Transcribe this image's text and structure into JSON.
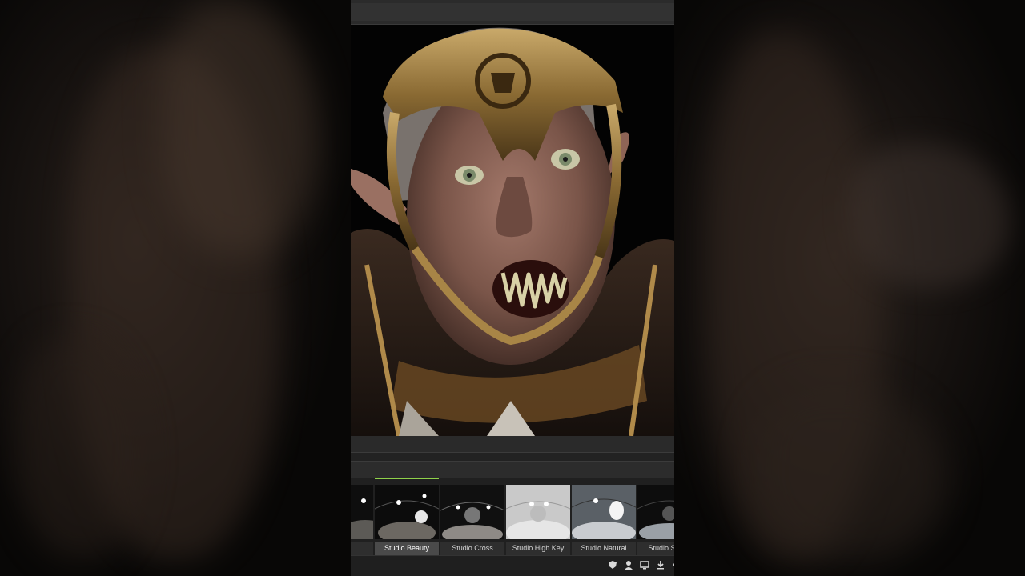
{
  "viewer": {
    "subject": "orc-warrior-bust-render"
  },
  "hdri_presets": {
    "items": [
      {
        "label": "",
        "selected": false
      },
      {
        "label": "Studio Beauty",
        "selected": true
      },
      {
        "label": "Studio Cross",
        "selected": false
      },
      {
        "label": "Studio High Key",
        "selected": false
      },
      {
        "label": "Studio Natural",
        "selected": false
      },
      {
        "label": "Studio Single",
        "selected": false
      }
    ]
  },
  "toolbar_icons": [
    "shield-icon",
    "user-icon",
    "monitor-icon",
    "download-icon",
    "more-icon"
  ],
  "colors": {
    "accent": "#8fd24a",
    "panel": "#1b1b1b"
  }
}
